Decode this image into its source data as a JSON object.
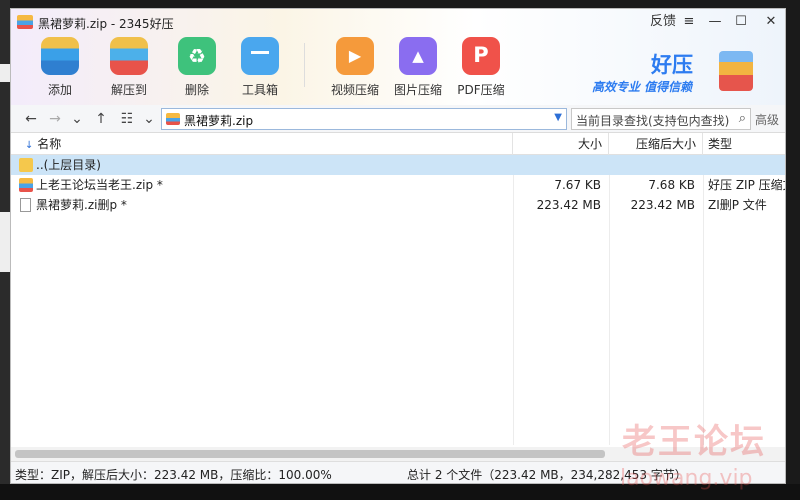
{
  "window": {
    "title": "黑裙萝莉.zip - 2345好压",
    "feedback": "反馈",
    "menu_glyph": "≡",
    "minimize_glyph": "—",
    "maximize_glyph": "☐",
    "close_glyph": "✕"
  },
  "toolbar": {
    "items": [
      {
        "label": "添加",
        "icon": "add-archive-icon"
      },
      {
        "label": "解压到",
        "icon": "extract-icon"
      },
      {
        "label": "删除",
        "icon": "recycle-icon"
      },
      {
        "label": "工具箱",
        "icon": "toolbox-icon"
      },
      {
        "label": "视频压缩",
        "icon": "video-compress-icon"
      },
      {
        "label": "图片压缩",
        "icon": "image-compress-icon"
      },
      {
        "label": "PDF压缩",
        "icon": "pdf-compress-icon"
      }
    ]
  },
  "brand": {
    "name": "好压",
    "slogan": "高效专业  值得信赖"
  },
  "navbar": {
    "back_glyph": "←",
    "forward_glyph": "→",
    "history_glyph": "⌄",
    "up_glyph": "↑",
    "view_glyph": "☷",
    "view_drop_glyph": "⌄",
    "path": "黑裙萝莉.zip",
    "path_drop_glyph": "▼",
    "search_placeholder": "当前目录查找(支持包内查找)",
    "search_glyph": "⌕",
    "advanced_label": "高级"
  },
  "columns": {
    "sort_glyph": "↓",
    "name": "名称",
    "size": "大小",
    "packed": "压缩后大小",
    "type": "类型"
  },
  "files": [
    {
      "name": "..(上层目录)",
      "size": "",
      "packed": "",
      "type": "",
      "icon": "folder-icon",
      "selected": true
    },
    {
      "name": "上老王论坛当老王.zip *",
      "size": "7.67 KB",
      "packed": "7.68 KB",
      "type": "好压 ZIP 压缩文",
      "icon": "zip-file-icon",
      "selected": false
    },
    {
      "name": "黑裙萝莉.zi删p *",
      "size": "223.42 MB",
      "packed": "223.42 MB",
      "type": "ZI删P 文件",
      "icon": "document-icon",
      "selected": false
    }
  ],
  "status": {
    "left": "类型：ZIP，解压后大小：223.42 MB，压缩比：100.00%",
    "right": "总计 2 个文件（223.42 MB，234,282,453 字节）"
  },
  "watermark": {
    "text": "老王论坛",
    "url": "laowang.vip"
  }
}
